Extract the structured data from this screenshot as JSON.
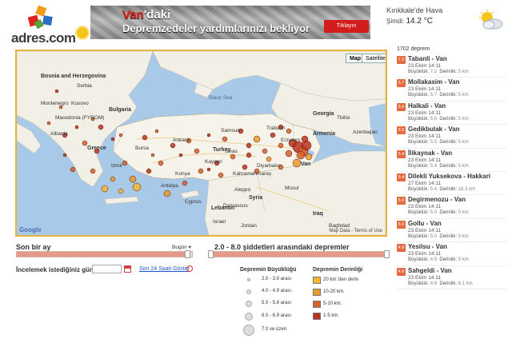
{
  "logo": {
    "text": "adres.com"
  },
  "banner": {
    "highlight": "Van",
    "suffix": "'daki",
    "line2": "Depremzedeler yardımlarınızı bekliyor",
    "button": "Tıklayın"
  },
  "weather": {
    "title": "Kırıkkale'de Hava",
    "now_label": "Şimdi:",
    "temp": "14.2 °C",
    "icon": "partly-cloudy-icon"
  },
  "map": {
    "type_map": "Map",
    "type_satellite": "Satellite",
    "google_text": "Google",
    "map_data_text": "Map Data - Terms of Use",
    "labels": [
      "Bosnia and Herzegovina",
      "Serbia",
      "Montenegro",
      "Kosovo",
      "Macedonia (FYROM)",
      "Bulgaria",
      "Black Sea",
      "Albania",
      "Greece",
      "Turkey",
      "Kayseri",
      "Ankara",
      "Samsun",
      "Kahramanmaraş",
      "Diyarbakır",
      "Van",
      "Armenia",
      "Georgia",
      "Azerbaijan",
      "Erzurum",
      "Konya",
      "Antalya",
      "Cyprus",
      "Lebanon",
      "Syria",
      "Iraq",
      "Jordan",
      "Israel",
      "Tbilisi",
      "Baghdad",
      "İzmir",
      "Bursa",
      "Mosul",
      "Damascus",
      "Aleppo",
      "Trabzon",
      "Sivas"
    ],
    "markers_count": 60
  },
  "quake_list": {
    "count_label": "1702 deprem",
    "items": [
      {
        "mag": "7.2",
        "name": "Tabanli - Van",
        "date": "23 Ekim 14:11",
        "mag_label": "Büyüklük:",
        "mag_val": "7.2",
        "depth_label": "Derinlik:",
        "depth_val": "5 km"
      },
      {
        "mag": "5.7",
        "name": "Mollakasim - Van",
        "date": "23 Ekim 14:11",
        "mag_label": "Büyüklük:",
        "mag_val": "5.7",
        "depth_label": "Derinlik:",
        "depth_val": "5 km"
      },
      {
        "mag": "5.6",
        "name": "Halkali - Van",
        "date": "23 Ekim 14:11",
        "mag_label": "Büyüklük:",
        "mag_val": "5.6",
        "depth_label": "Derinlik:",
        "depth_val": "5 km"
      },
      {
        "mag": "5.5",
        "name": "Gedikbulak - Van",
        "date": "23 Ekim 14:11",
        "mag_label": "Büyüklük:",
        "mag_val": "5.5",
        "depth_label": "Derinlik:",
        "depth_val": "5 km"
      },
      {
        "mag": "5.4",
        "name": "İlikaynak - Van",
        "date": "23 Ekim 14:11",
        "mag_label": "Büyüklük:",
        "mag_val": "5.4",
        "depth_label": "Derinlik:",
        "depth_val": "5 km"
      },
      {
        "mag": "5.4",
        "name": "Dilekli Yuksekova - Hakkari",
        "date": "27 Ekim 14:11",
        "mag_label": "Büyüklük:",
        "mag_val": "5.4",
        "depth_label": "Derinlik:",
        "depth_val": "18.3 km"
      },
      {
        "mag": "5.0",
        "name": "Degirmenozu - Van",
        "date": "23 Ekim 14:11",
        "mag_label": "Büyüklük:",
        "mag_val": "5.0",
        "depth_label": "Derinlik:",
        "depth_val": "5 km"
      },
      {
        "mag": "5.0",
        "name": "Gollu - Van",
        "date": "23 Ekim 14:11",
        "mag_label": "Büyüklük:",
        "mag_val": "5.0",
        "depth_label": "Derinlik:",
        "depth_val": "5 km"
      },
      {
        "mag": "4.9",
        "name": "Yesilsu - Van",
        "date": "23 Ekim 14:11",
        "mag_label": "Büyüklük:",
        "mag_val": "4.9",
        "depth_label": "Derinlik:",
        "depth_val": "5 km"
      },
      {
        "mag": "4.8",
        "name": "Sahgeldi - Van",
        "date": "23 Ekim 14:11",
        "mag_label": "Büyüklük:",
        "mag_val": "4.8",
        "depth_label": "Derinlik:",
        "depth_val": "6.1 km"
      }
    ]
  },
  "time_slider": {
    "label": "Son bir ay",
    "today": "Bugün",
    "fill_fraction": 0.97
  },
  "range_slider": {
    "label": "2.0 - 8.0 şiddetleri arasındaki depremler",
    "fill_fraction": 1.0
  },
  "date_picker": {
    "label": "İncelemek istediğiniz gün:",
    "value": "",
    "link": "Son 24 Saati Göster"
  },
  "legend_mag": {
    "title": "Depremin Büyüklüğü",
    "rows": [
      "2.0 - 3.9 arası",
      "4.0 - 4.9 arası",
      "5.0 - 5.8 arası",
      "6.0 - 6.9 arası",
      "7.0 ve üzeri"
    ]
  },
  "legend_depth": {
    "title": "Depremin Derinliği",
    "rows": [
      {
        "label": "20 km.'den derin",
        "color": "#f5b82e"
      },
      {
        "label": "10-20 km.",
        "color": "#e89a2a"
      },
      {
        "label": "5-10 km.",
        "color": "#d4602a"
      },
      {
        "label": "1-5 km.",
        "color": "#b8331f"
      }
    ]
  }
}
